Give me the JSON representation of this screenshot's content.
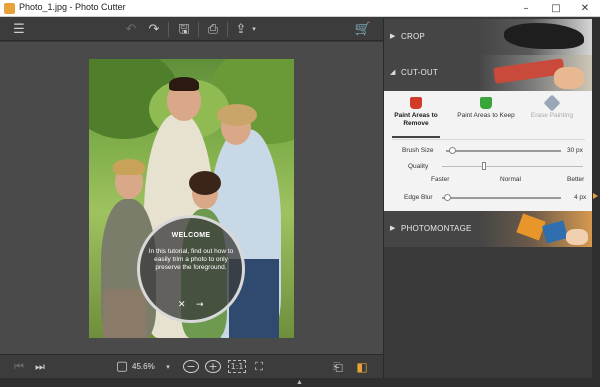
{
  "window": {
    "title": "Photo_1.jpg - Photo Cutter",
    "minimize_glyph": "–",
    "maximize_glyph": "□",
    "close_glyph": "✕"
  },
  "toolbar": {
    "icons": [
      "menu-icon",
      "undo-icon",
      "redo-icon",
      "save-icon",
      "print-icon",
      "share-icon",
      "cart-icon"
    ],
    "menu_glyph": "☰",
    "undo_glyph": "↶",
    "redo_glyph": "↷",
    "save_glyph": "🖫",
    "print_glyph": "⎙",
    "share_glyph": "⇪",
    "share_caret": "▾",
    "cart_glyph": "🛒"
  },
  "welcome": {
    "title": "WELCOME",
    "body": "In this tutorial, find out how to easily trim a photo to only preserve the foreground.",
    "close_glyph": "✕",
    "next_glyph": "→"
  },
  "bottombar": {
    "first_glyph": "⏮",
    "last_glyph": "⏭",
    "fit_glyph": "▢",
    "zoom_level": "45.6%",
    "zoom_caret": "▾",
    "zoom_out_glyph": "−",
    "zoom_in_glyph": "+",
    "actual_size_glyph": "1:1",
    "fit_screen_glyph": "⛶",
    "export_glyph": "⎗",
    "compare_glyph": "◧"
  },
  "panel": {
    "sections": [
      {
        "label": "CROP",
        "chevron": "▶"
      },
      {
        "label": "CUT-OUT",
        "chevron": "◢"
      },
      {
        "label": "PHOTOMONTAGE",
        "chevron": "▶"
      }
    ],
    "tools": [
      {
        "label": "Paint Areas to Remove",
        "color": "#d23b2a",
        "state": "active"
      },
      {
        "label": "Paint Areas to Keep",
        "color": "#3aa53a",
        "state": "normal"
      },
      {
        "label": "Erase Painting",
        "color": "#9aa7b8",
        "state": "disabled"
      }
    ],
    "brush_size": {
      "label": "Brush Size",
      "value": "30 px",
      "level": 0.06
    },
    "quality": {
      "label": "Quality",
      "options": [
        "Faster",
        "Normal",
        "Better"
      ],
      "level": 0.3
    },
    "edge_blur": {
      "label": "Edge Blur",
      "value": "4 px",
      "level": 0.05
    }
  },
  "colors": {
    "accent": "#e8a23a",
    "panel_bg": "#3a3a3a",
    "subpanel_bg": "#f3f3f3",
    "remove_red": "#d23b2a",
    "keep_green": "#3aa53a"
  }
}
